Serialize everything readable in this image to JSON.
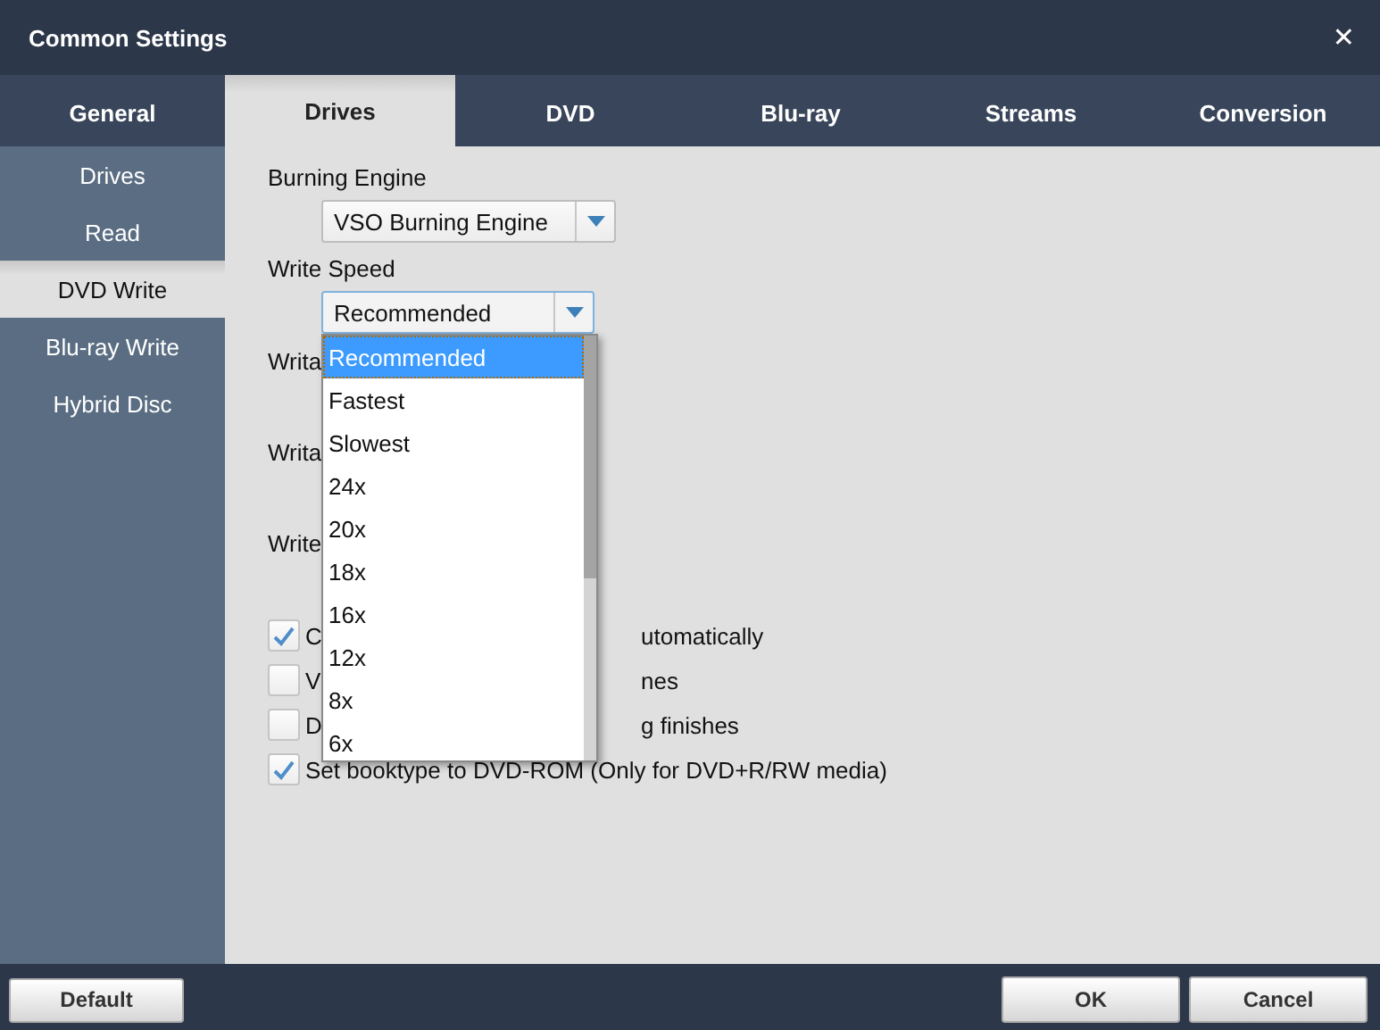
{
  "window": {
    "title": "Common Settings",
    "close": "✕"
  },
  "tabs": [
    {
      "label": "General",
      "selected": false
    },
    {
      "label": "Drives",
      "selected": true
    },
    {
      "label": "DVD",
      "selected": false
    },
    {
      "label": "Blu-ray",
      "selected": false
    },
    {
      "label": "Streams",
      "selected": false
    },
    {
      "label": "Conversion",
      "selected": false
    }
  ],
  "sidebar": {
    "items": [
      {
        "label": "Drives",
        "selected": false
      },
      {
        "label": "Read",
        "selected": false
      },
      {
        "label": "DVD Write",
        "selected": true
      },
      {
        "label": "Blu-ray Write",
        "selected": false
      },
      {
        "label": "Hybrid Disc",
        "selected": false
      }
    ]
  },
  "burning_engine": {
    "label": "Burning Engine",
    "value": "VSO Burning Engine"
  },
  "write_speed": {
    "label": "Write Speed",
    "value": "Recommended",
    "expanded": true,
    "options": [
      {
        "label": "Recommended",
        "selected": true
      },
      {
        "label": "Fastest",
        "selected": false
      },
      {
        "label": "Slowest",
        "selected": false
      },
      {
        "label": "24x",
        "selected": false
      },
      {
        "label": "20x",
        "selected": false
      },
      {
        "label": "18x",
        "selected": false
      },
      {
        "label": "16x",
        "selected": false
      },
      {
        "label": "12x",
        "selected": false
      },
      {
        "label": "8x",
        "selected": false
      },
      {
        "label": "6x",
        "selected": false
      }
    ]
  },
  "covered_labels": [
    "Writa",
    "Writa",
    "Write"
  ],
  "checkboxes": [
    {
      "checked": true,
      "text_start": "C",
      "text_end": "utomatically"
    },
    {
      "checked": false,
      "text_start": "V",
      "text_end": "nes"
    },
    {
      "checked": false,
      "text_start": "D",
      "text_end": "g finishes"
    },
    {
      "checked": true,
      "text_start": "Set booktype to DVD-ROM (Only for DVD+R/RW media)"
    }
  ],
  "buttons": {
    "left": [
      "Default"
    ],
    "right": [
      "OK",
      "Cancel"
    ]
  }
}
